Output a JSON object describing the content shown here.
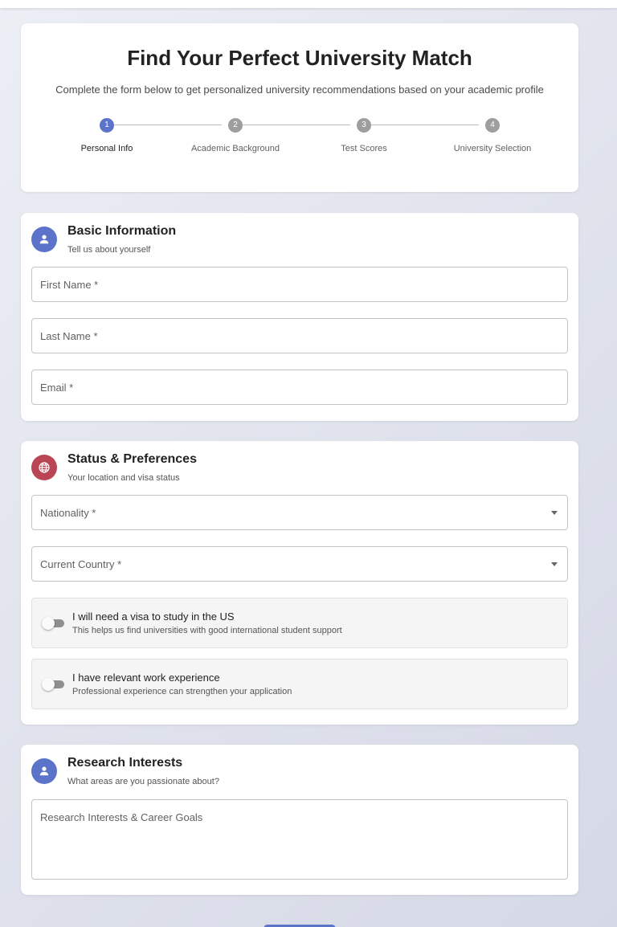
{
  "header": {
    "title": "Find Your Perfect University Match",
    "subtitle": "Complete the form below to get personalized university recommendations based on your academic profile"
  },
  "stepper": {
    "steps": [
      {
        "number": "1",
        "label": "Personal Info",
        "active": true
      },
      {
        "number": "2",
        "label": "Academic Background",
        "active": false
      },
      {
        "number": "3",
        "label": "Test Scores",
        "active": false
      },
      {
        "number": "4",
        "label": "University Selection",
        "active": false
      }
    ]
  },
  "basic_info": {
    "title": "Basic Information",
    "subtitle": "Tell us about yourself",
    "icon": "person-icon",
    "fields": {
      "first_name": "First Name *",
      "last_name": "Last Name *",
      "email": "Email *"
    }
  },
  "status": {
    "title": "Status & Preferences",
    "subtitle": "Your location and visa status",
    "icon": "globe-icon",
    "nationality": "Nationality *",
    "current_country": "Current Country *",
    "visa_toggle": {
      "title": "I will need a visa to study in the US",
      "subtitle": "This helps us find universities with good international student support",
      "checked": false
    },
    "work_toggle": {
      "title": "I have relevant work experience",
      "subtitle": "Professional experience can strengthen your application",
      "checked": false
    }
  },
  "research": {
    "title": "Research Interests",
    "subtitle": "What areas are you passionate about?",
    "icon": "person-icon",
    "textarea_placeholder": "Research Interests & Career Goals"
  },
  "colors": {
    "accent": "#5b74c9",
    "accent_red": "#b94555",
    "inactive_step": "#9e9e9e"
  }
}
